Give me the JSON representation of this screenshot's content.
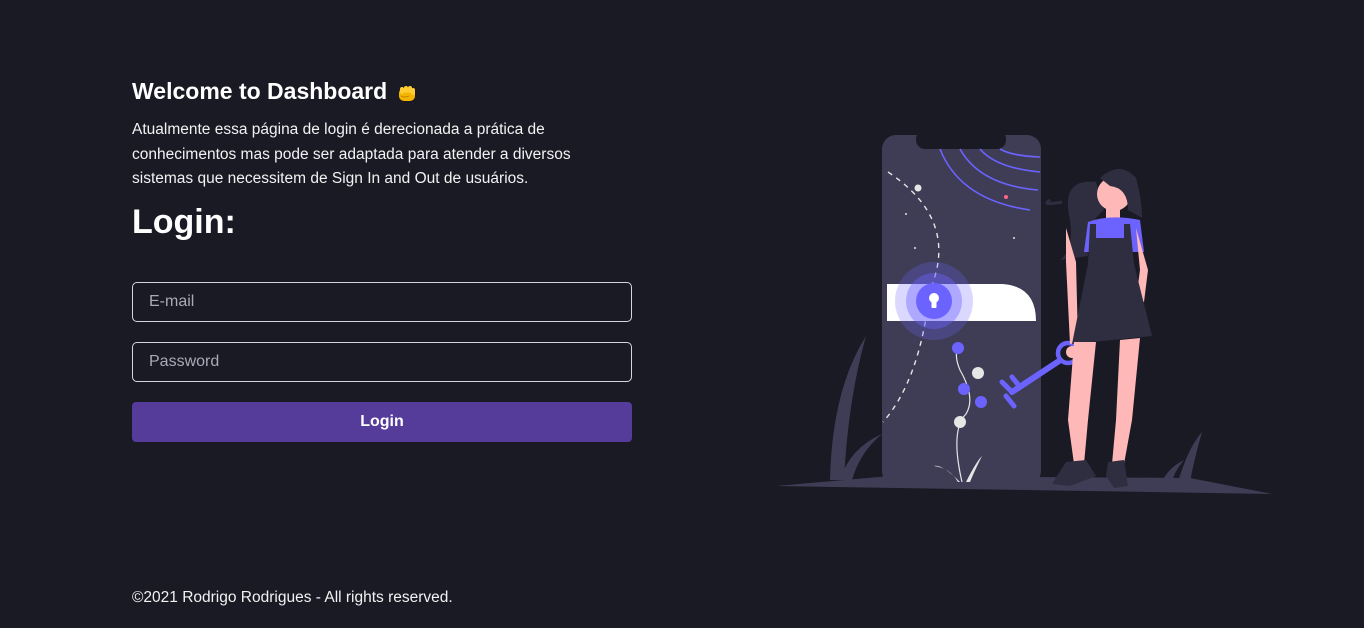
{
  "header": {
    "welcome_title": "Welcome to Dashboard",
    "welcome_emoji": "fist-bump-icon",
    "description": "Atualmente essa página de login é derecionada a prática de conhecimentos mas pode ser adaptada para atender a diversos sistemas que necessitem de Sign In and Out de usuários."
  },
  "form": {
    "title": "Login:",
    "email": {
      "placeholder": "E-mail",
      "value": ""
    },
    "password": {
      "placeholder": "Password",
      "value": ""
    },
    "submit_label": "Login"
  },
  "footer": {
    "text": "©2021 Rodrigo Rodrigues - All rights reserved."
  },
  "colors": {
    "background": "#1a1a24",
    "accent": "#553c9a",
    "illustration_primary": "#6c63ff",
    "illustration_dark": "#3f3d56"
  }
}
